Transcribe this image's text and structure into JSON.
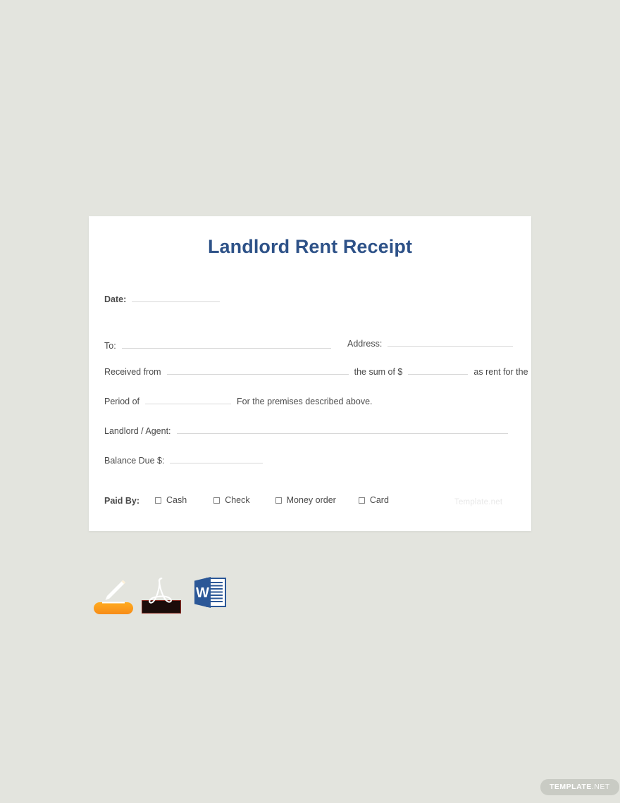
{
  "background_color": "#e3e4de",
  "document": {
    "title": "Landlord Rent Receipt",
    "title_color": "#2e5288",
    "fields": {
      "date_label": "Date:",
      "to_label": "To:",
      "address_label": "Address:",
      "received_from_label": "Received from",
      "the_sum_of_label": "the sum of $",
      "as_rent_for_the_label": "as rent for the",
      "period_of_label": "Period of",
      "premises_text": "For the premises described above.",
      "landlord_agent_label": "Landlord / Agent:",
      "balance_due_label": "Balance Due $:"
    },
    "paid_by": {
      "label": "Paid By:",
      "options": [
        {
          "label": "Cash",
          "checked": false
        },
        {
          "label": "Check",
          "checked": false
        },
        {
          "label": "Money order",
          "checked": false
        },
        {
          "label": "Card",
          "checked": false
        }
      ]
    },
    "watermark": "Template.net"
  },
  "file_formats": [
    {
      "name": "Apple Pages",
      "icon": "pages-icon",
      "color": "#f79019"
    },
    {
      "name": "PDF",
      "icon": "pdf-icon",
      "color": "#1c0c0a"
    },
    {
      "name": "Microsoft Word",
      "icon": "word-icon",
      "color": "#2b5797"
    }
  ],
  "footer_badge": {
    "primary": "TEMPLATE",
    "secondary": ".NET"
  }
}
